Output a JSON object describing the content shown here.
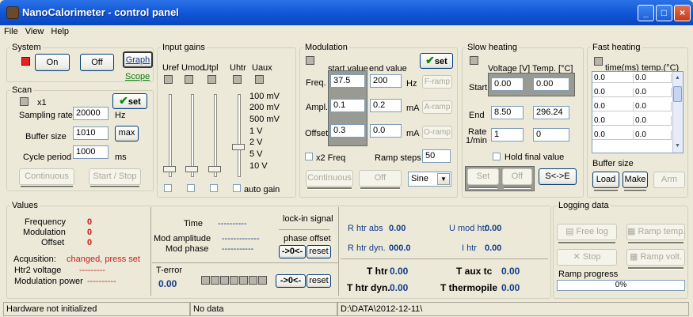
{
  "window": {
    "title": "NanoCalorimeter - control panel",
    "min": "_",
    "max": "□",
    "close": "×"
  },
  "menu": [
    "File",
    "View",
    "Help"
  ],
  "system": {
    "legend": "System",
    "on": "On",
    "off": "Off",
    "graph": "Graph",
    "scope": "Scope"
  },
  "scan": {
    "legend": "Scan",
    "x1": "x1",
    "set": "set",
    "sampling_label": "Sampling rate",
    "sampling_value": "20000",
    "sampling_unit": "Hz",
    "buffer_label": "Buffer size",
    "buffer_value": "1010",
    "max": "max",
    "cycle_label": "Cycle period",
    "cycle_value": "1000",
    "cycle_unit": "ms",
    "continuous": "Continuous",
    "startstop": "Start / Stop"
  },
  "gains": {
    "legend": "Input gains",
    "channels": [
      "Uref",
      "Umod",
      "Utpl",
      "Uhtr",
      "Uaux"
    ],
    "levels": [
      "100 mV",
      "200 mV",
      "500 mV",
      "1 V",
      "2 V",
      "5 V",
      "10 V"
    ],
    "auto": "auto gain"
  },
  "modulation": {
    "legend": "Modulation",
    "start": "start value",
    "end": "end value",
    "set": "set",
    "freq_label": "Freq.",
    "freq_start": "37.5",
    "freq_end": "200",
    "freq_unit": "Hz",
    "framp": "F-ramp",
    "ampl_label": "Ampl.",
    "ampl_start": "0.1",
    "ampl_end": "0.2",
    "ampl_unit": "mA",
    "aramp": "A-ramp",
    "offset_label": "Offset",
    "offset_start": "0.3",
    "offset_end": "0.0",
    "offset_unit": "mA",
    "oramp": "O-ramp",
    "x2": "x2 Freq",
    "ramp_steps_label": "Ramp steps",
    "ramp_steps": "50",
    "continuous": "Continuous",
    "off": "Off",
    "waveform": "Sine"
  },
  "slow": {
    "legend": "Slow heating",
    "voltage": "Voltage [V]",
    "temp": "Temp. [°C]",
    "start_label": "Start",
    "start_v": "0.00",
    "start_t": "0.00",
    "end_label": "End",
    "end_v": "8.50",
    "end_t": "296.24",
    "rate_label": "Rate",
    "rate_unit": "1/min",
    "rate_v": "1",
    "rate_t": "0",
    "hold": "Hold final value",
    "set": "Set",
    "off": "Off",
    "swap": "S<->E"
  },
  "fast": {
    "legend": "Fast heating",
    "col1": "time(ms)",
    "col2": "temp.(°C)",
    "rows": [
      [
        "0.0",
        "0.0"
      ],
      [
        "0.0",
        "0.0"
      ],
      [
        "0.0",
        "0.0"
      ],
      [
        "0.0",
        "0.0"
      ],
      [
        "0.0",
        "0.0"
      ]
    ],
    "buffer": "Buffer size",
    "load": "Load",
    "make": "Make",
    "arm": "Arm"
  },
  "values": {
    "legend": "Values",
    "frequency": "Frequency",
    "frequency_v": "0",
    "modulation": "Modulation",
    "modulation_v": "0",
    "offset": "Offset",
    "offset_v": "0",
    "acq_label": "Acqusition:",
    "acq_value": "changed, press set",
    "htr2": "Htr2 voltage",
    "htr2_v": "---------",
    "modpow": "Modulation power",
    "modpow_v": "----------",
    "time": "Time",
    "time_v": "----------",
    "modamp": "Mod amplitude",
    "modamp_v": "-------------",
    "modphase": "Mod phase",
    "modphase_v": "-----------",
    "lockin": "lock-in signal",
    "phase_offset": "phase offset",
    "zero": "->0<-",
    "reset": "reset",
    "terror": "T-error",
    "terror_v": "0.00",
    "zero2": "->0<-",
    "reset2": "reset",
    "rhtr_abs": "R htr abs",
    "rhtr_abs_v": "0.00",
    "rhtr_dyn": "R htr dyn.",
    "rhtr_dyn_v": "000.0",
    "umod": "U mod htr",
    "umod_v": "0.00",
    "ihtr": "I htr",
    "ihtr_v": "0.00",
    "thtr": "T htr",
    "thtr_v": "0.00",
    "thtr_dyn": "T htr dyn.",
    "thtr_dyn_v": "0.00",
    "taux": "T aux tc",
    "taux_v": "0.00",
    "tthermo": "T thermopile",
    "tthermo_v": "0.00"
  },
  "logging": {
    "legend": "Logging data",
    "freelog": "Free log",
    "ramptemp": "Ramp temp.",
    "stop": "Stop",
    "rampvolt": "Ramp volt.",
    "progress_label": "Ramp progress",
    "progress_percent": 0,
    "progress_text": "0%"
  },
  "status": {
    "hw": "Hardware not initialized",
    "data": "No data",
    "path": "D:\\DATA\\2012-12-11\\"
  }
}
